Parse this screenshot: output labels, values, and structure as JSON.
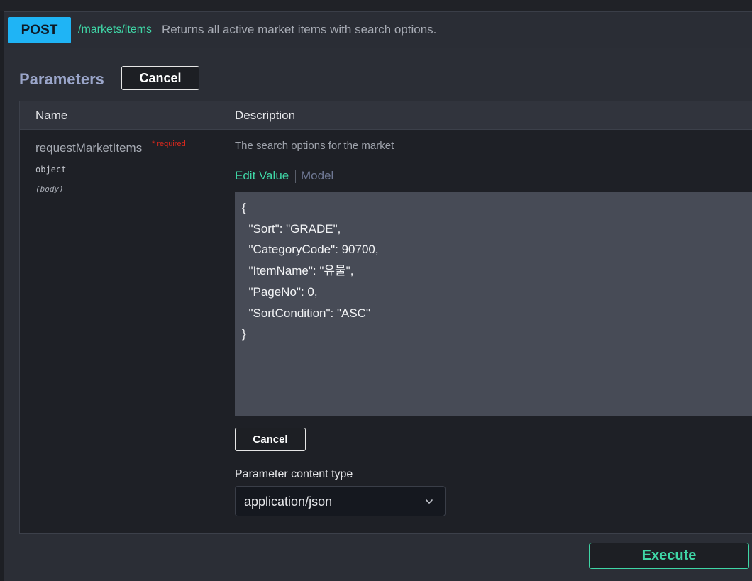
{
  "operation": {
    "method": "POST",
    "path": "/markets/items",
    "summary": "Returns all active market items with search options."
  },
  "parameters": {
    "title": "Parameters",
    "cancel_label": "Cancel",
    "columns": {
      "name": "Name",
      "description": "Description"
    },
    "param": {
      "name": "requestMarketItems",
      "required_label": "* required",
      "type": "object",
      "in": "(body)",
      "description": "The search options for the market"
    },
    "tabs": {
      "edit_value": "Edit Value",
      "model": "Model"
    },
    "body_value": "{\n  \"Sort\": \"GRADE\",\n  \"CategoryCode\": 90700,\n  \"ItemName\": \"유물\",\n  \"PageNo\": 0,\n  \"SortCondition\": \"ASC\"\n}",
    "editor_cancel_label": "Cancel",
    "content_type_label": "Parameter content type",
    "content_type_value": "application/json"
  },
  "execute_label": "Execute",
  "colors": {
    "post": "#1fb4f5",
    "accent": "#3fd6a6",
    "required": "#d9281d"
  },
  "icons": {
    "select_chevron": "chevron-down-icon"
  }
}
